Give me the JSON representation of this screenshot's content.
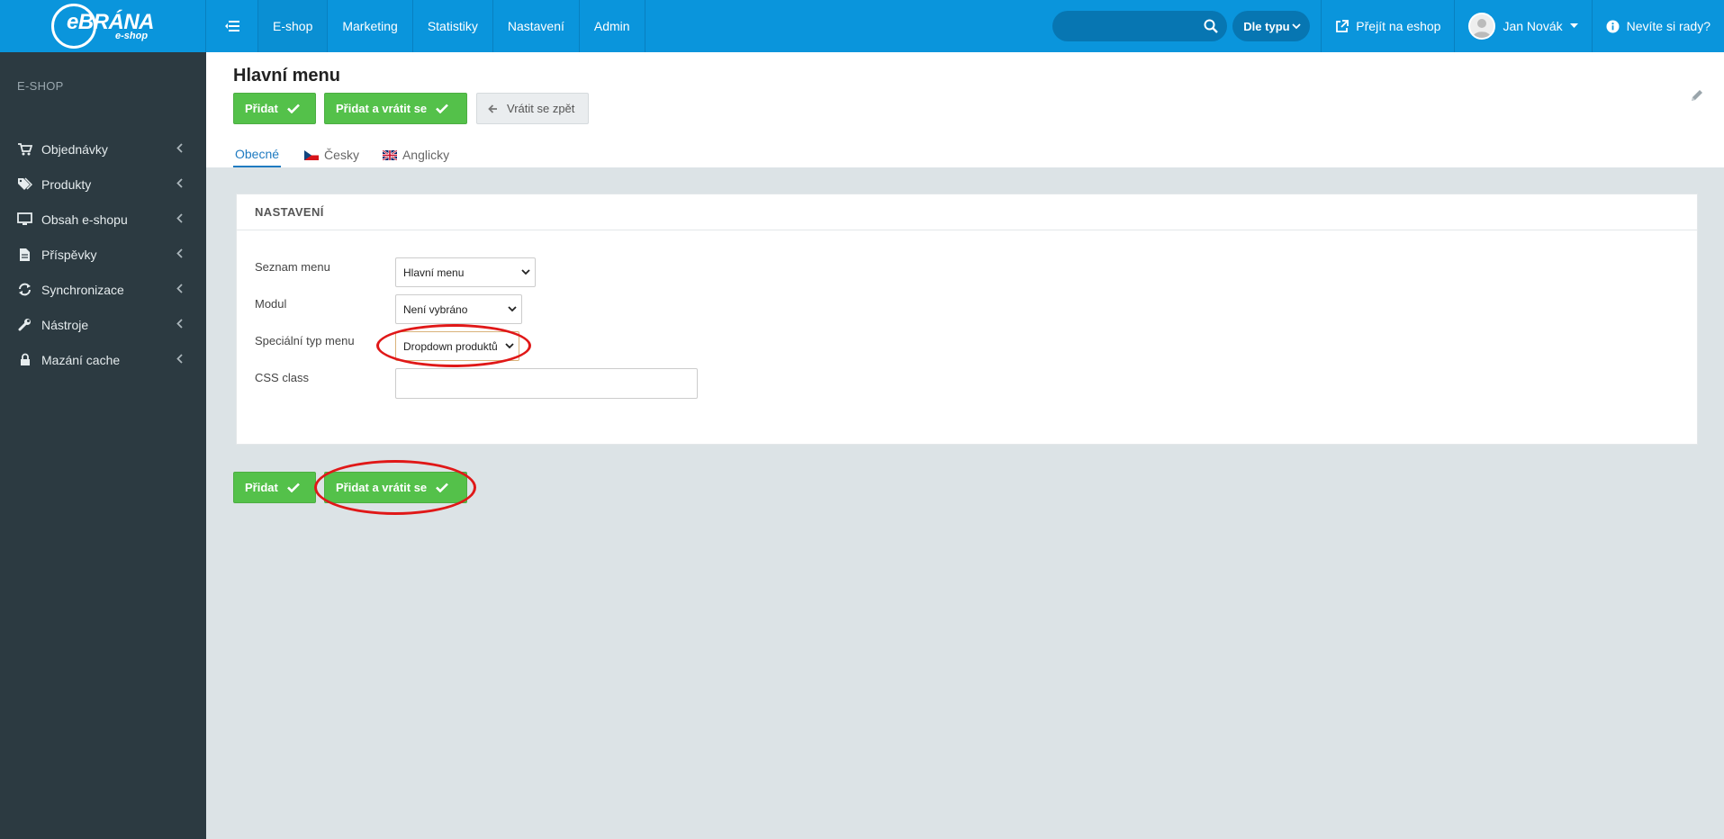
{
  "logo": {
    "main": "eBRÁNA",
    "sub": "e-shop"
  },
  "topnav": {
    "items": [
      "E-shop",
      "Marketing",
      "Statistiky",
      "Nastavení",
      "Admin"
    ]
  },
  "search": {
    "placeholder": "",
    "type_label": "Dle typu"
  },
  "top_links": {
    "eshop": "Přejít na eshop",
    "user": "Jan Novák",
    "help": "Nevíte si rady?"
  },
  "sidebar": {
    "heading": "E-SHOP",
    "items": [
      {
        "label": "Objednávky",
        "icon": "cart-icon"
      },
      {
        "label": "Produkty",
        "icon": "tags-icon"
      },
      {
        "label": "Obsah e-shopu",
        "icon": "monitor-icon"
      },
      {
        "label": "Příspěvky",
        "icon": "document-icon"
      },
      {
        "label": "Synchronizace",
        "icon": "sync-icon"
      },
      {
        "label": "Nástroje",
        "icon": "wrench-icon"
      },
      {
        "label": "Mazání cache",
        "icon": "lock-icon"
      }
    ]
  },
  "page": {
    "title": "Hlavní menu",
    "btn_add": "Přidat",
    "btn_add_back": "Přidat a vrátit se",
    "btn_back": "Vrátit se zpět"
  },
  "tabs": [
    "Obecné",
    "Česky",
    "Anglicky"
  ],
  "panel": {
    "heading": "NASTAVENÍ",
    "fields": [
      {
        "label": "Seznam menu",
        "value": "Hlavní menu"
      },
      {
        "label": "Modul",
        "value": "Není vybráno"
      },
      {
        "label": "Speciální typ menu",
        "value": "Dropdown produktů"
      },
      {
        "label": "CSS class",
        "value": ""
      }
    ]
  },
  "colors": {
    "topbar": "#0a95dc",
    "sidebar": "#2c3a41",
    "green": "#54c14a",
    "highlight": "#e01818"
  }
}
